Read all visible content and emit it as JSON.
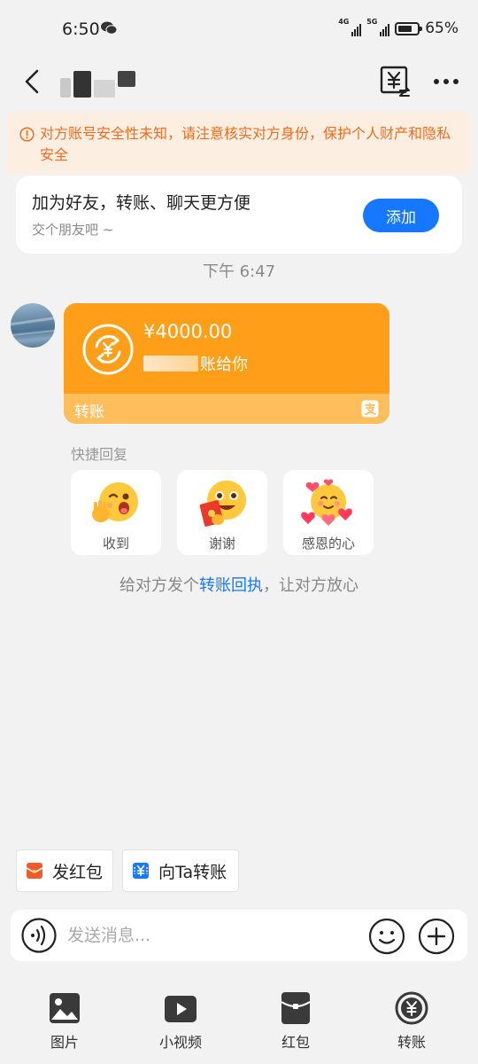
{
  "status_bar": {
    "time": "6:50",
    "network_1": "4G",
    "network_2": "5G",
    "battery_percent": "65%",
    "battery_level": 0.65
  },
  "nav": {
    "contact_name_redacted": true,
    "icons": [
      "back-arrow",
      "transfer-record",
      "more-dots"
    ]
  },
  "warning": {
    "text": "对方账号安全性未知，请注意核实对方身份，保护个人财产和隐私安全",
    "color": "#f26b1d"
  },
  "friend_card": {
    "title": "加为好友，转账、聊天更方便",
    "subtitle": "交个朋友吧 ~",
    "add_label": "添加"
  },
  "chat": {
    "timestamp": "下午 6:47"
  },
  "transfer": {
    "amount": "¥4000.00",
    "description": "账给你",
    "type_label": "转账",
    "card_color": "#ff9f19"
  },
  "quick_reply": {
    "label": "快捷回复",
    "items": [
      {
        "label": "收到",
        "icon": "wink-ok-emoji"
      },
      {
        "label": "谢谢",
        "icon": "thanks-red-envelope-emoji"
      },
      {
        "label": "感恩的心",
        "icon": "hearts-emoji"
      }
    ]
  },
  "receipt_hint": {
    "prefix": "给对方发个",
    "link": "转账回执",
    "suffix": "，让对方放心"
  },
  "shortcuts": {
    "red_packet": "发红包",
    "transfer_to": "向Ta转账"
  },
  "input": {
    "placeholder": "发送消息..."
  },
  "toolbar": {
    "items": [
      {
        "label": "图片",
        "icon": "image-icon"
      },
      {
        "label": "小视频",
        "icon": "video-icon"
      },
      {
        "label": "红包",
        "icon": "red-packet-icon"
      },
      {
        "label": "转账",
        "icon": "transfer-icon"
      }
    ]
  },
  "colors": {
    "accent_blue": "#1677ff",
    "transfer_orange": "#ff9f19",
    "warning_bg": "#fcefe2"
  }
}
